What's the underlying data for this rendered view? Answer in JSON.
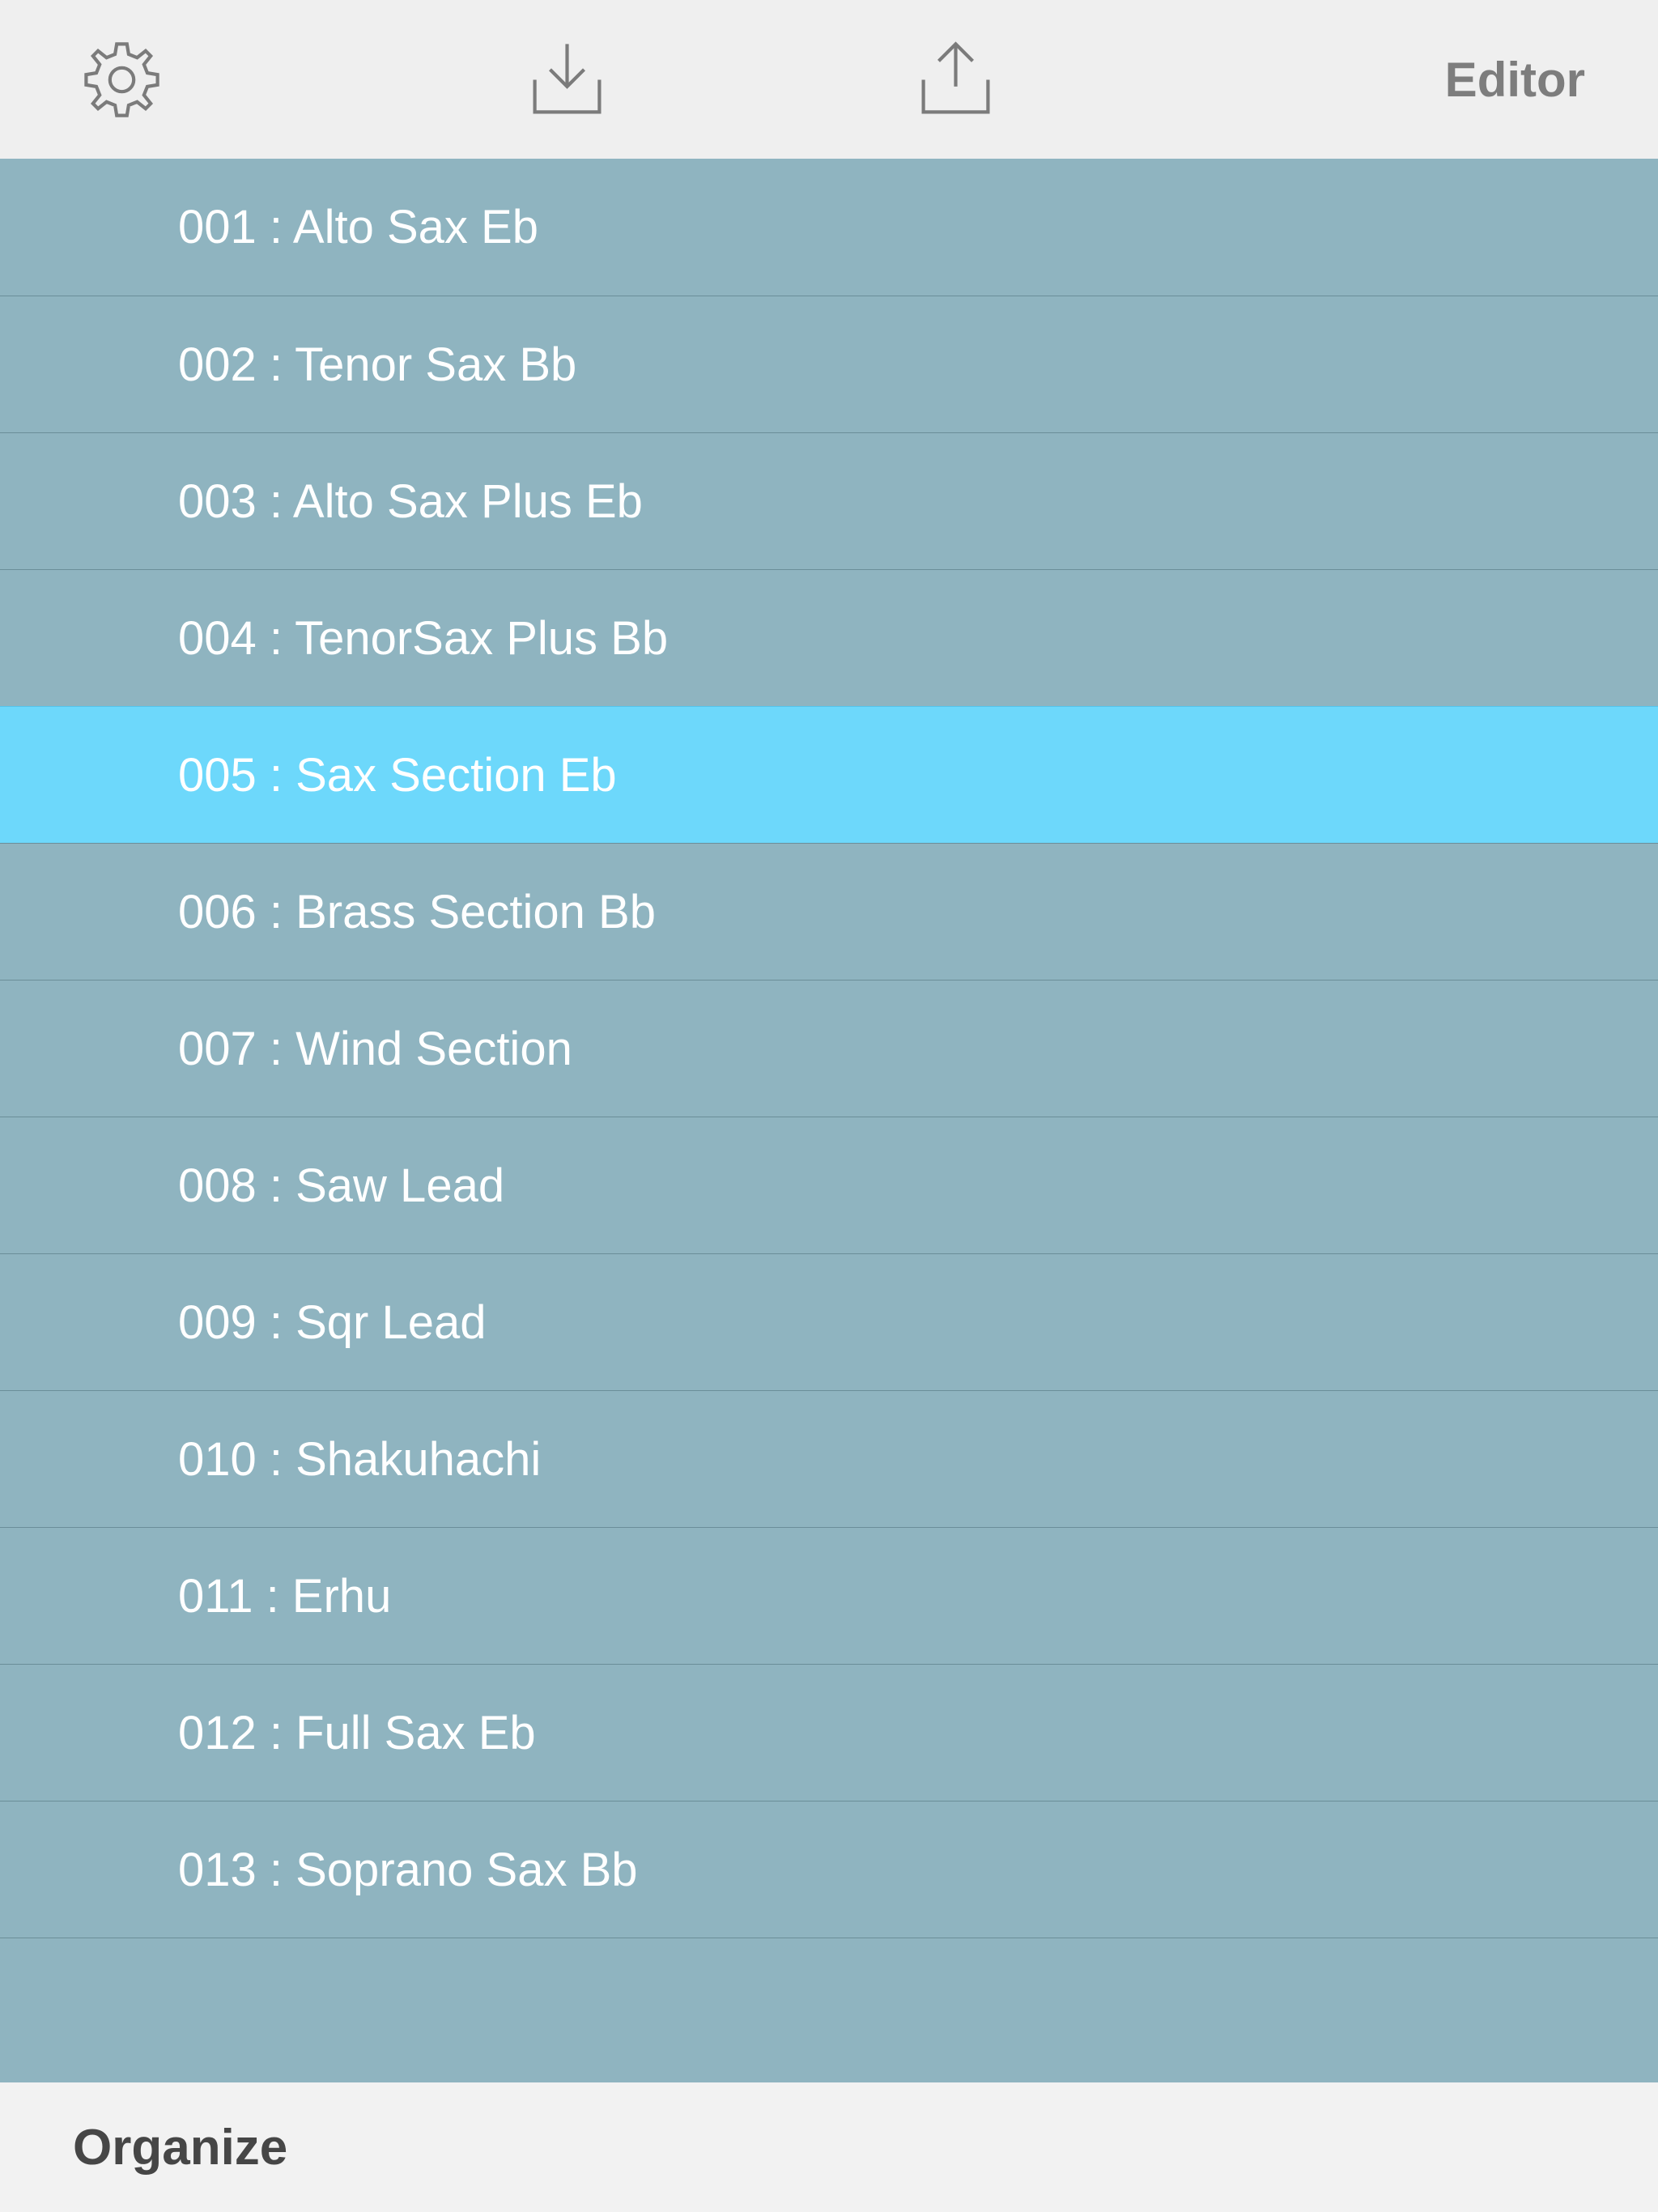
{
  "toolbar": {
    "editor_label": "Editor"
  },
  "list": {
    "selected_index": 4,
    "items": [
      {
        "label": "001 : Alto Sax Eb"
      },
      {
        "label": "002 : Tenor Sax Bb"
      },
      {
        "label": "003 : Alto Sax Plus Eb"
      },
      {
        "label": "004 : TenorSax Plus Bb"
      },
      {
        "label": "005 : Sax Section Eb"
      },
      {
        "label": "006 : Brass Section Bb"
      },
      {
        "label": "007 : Wind Section"
      },
      {
        "label": "008 : Saw Lead"
      },
      {
        "label": "009 : Sqr Lead"
      },
      {
        "label": "010 : Shakuhachi"
      },
      {
        "label": "011 : Erhu"
      },
      {
        "label": "012 : Full Sax Eb"
      },
      {
        "label": "013 : Soprano Sax Bb"
      }
    ]
  },
  "bottombar": {
    "organize_label": "Organize"
  }
}
